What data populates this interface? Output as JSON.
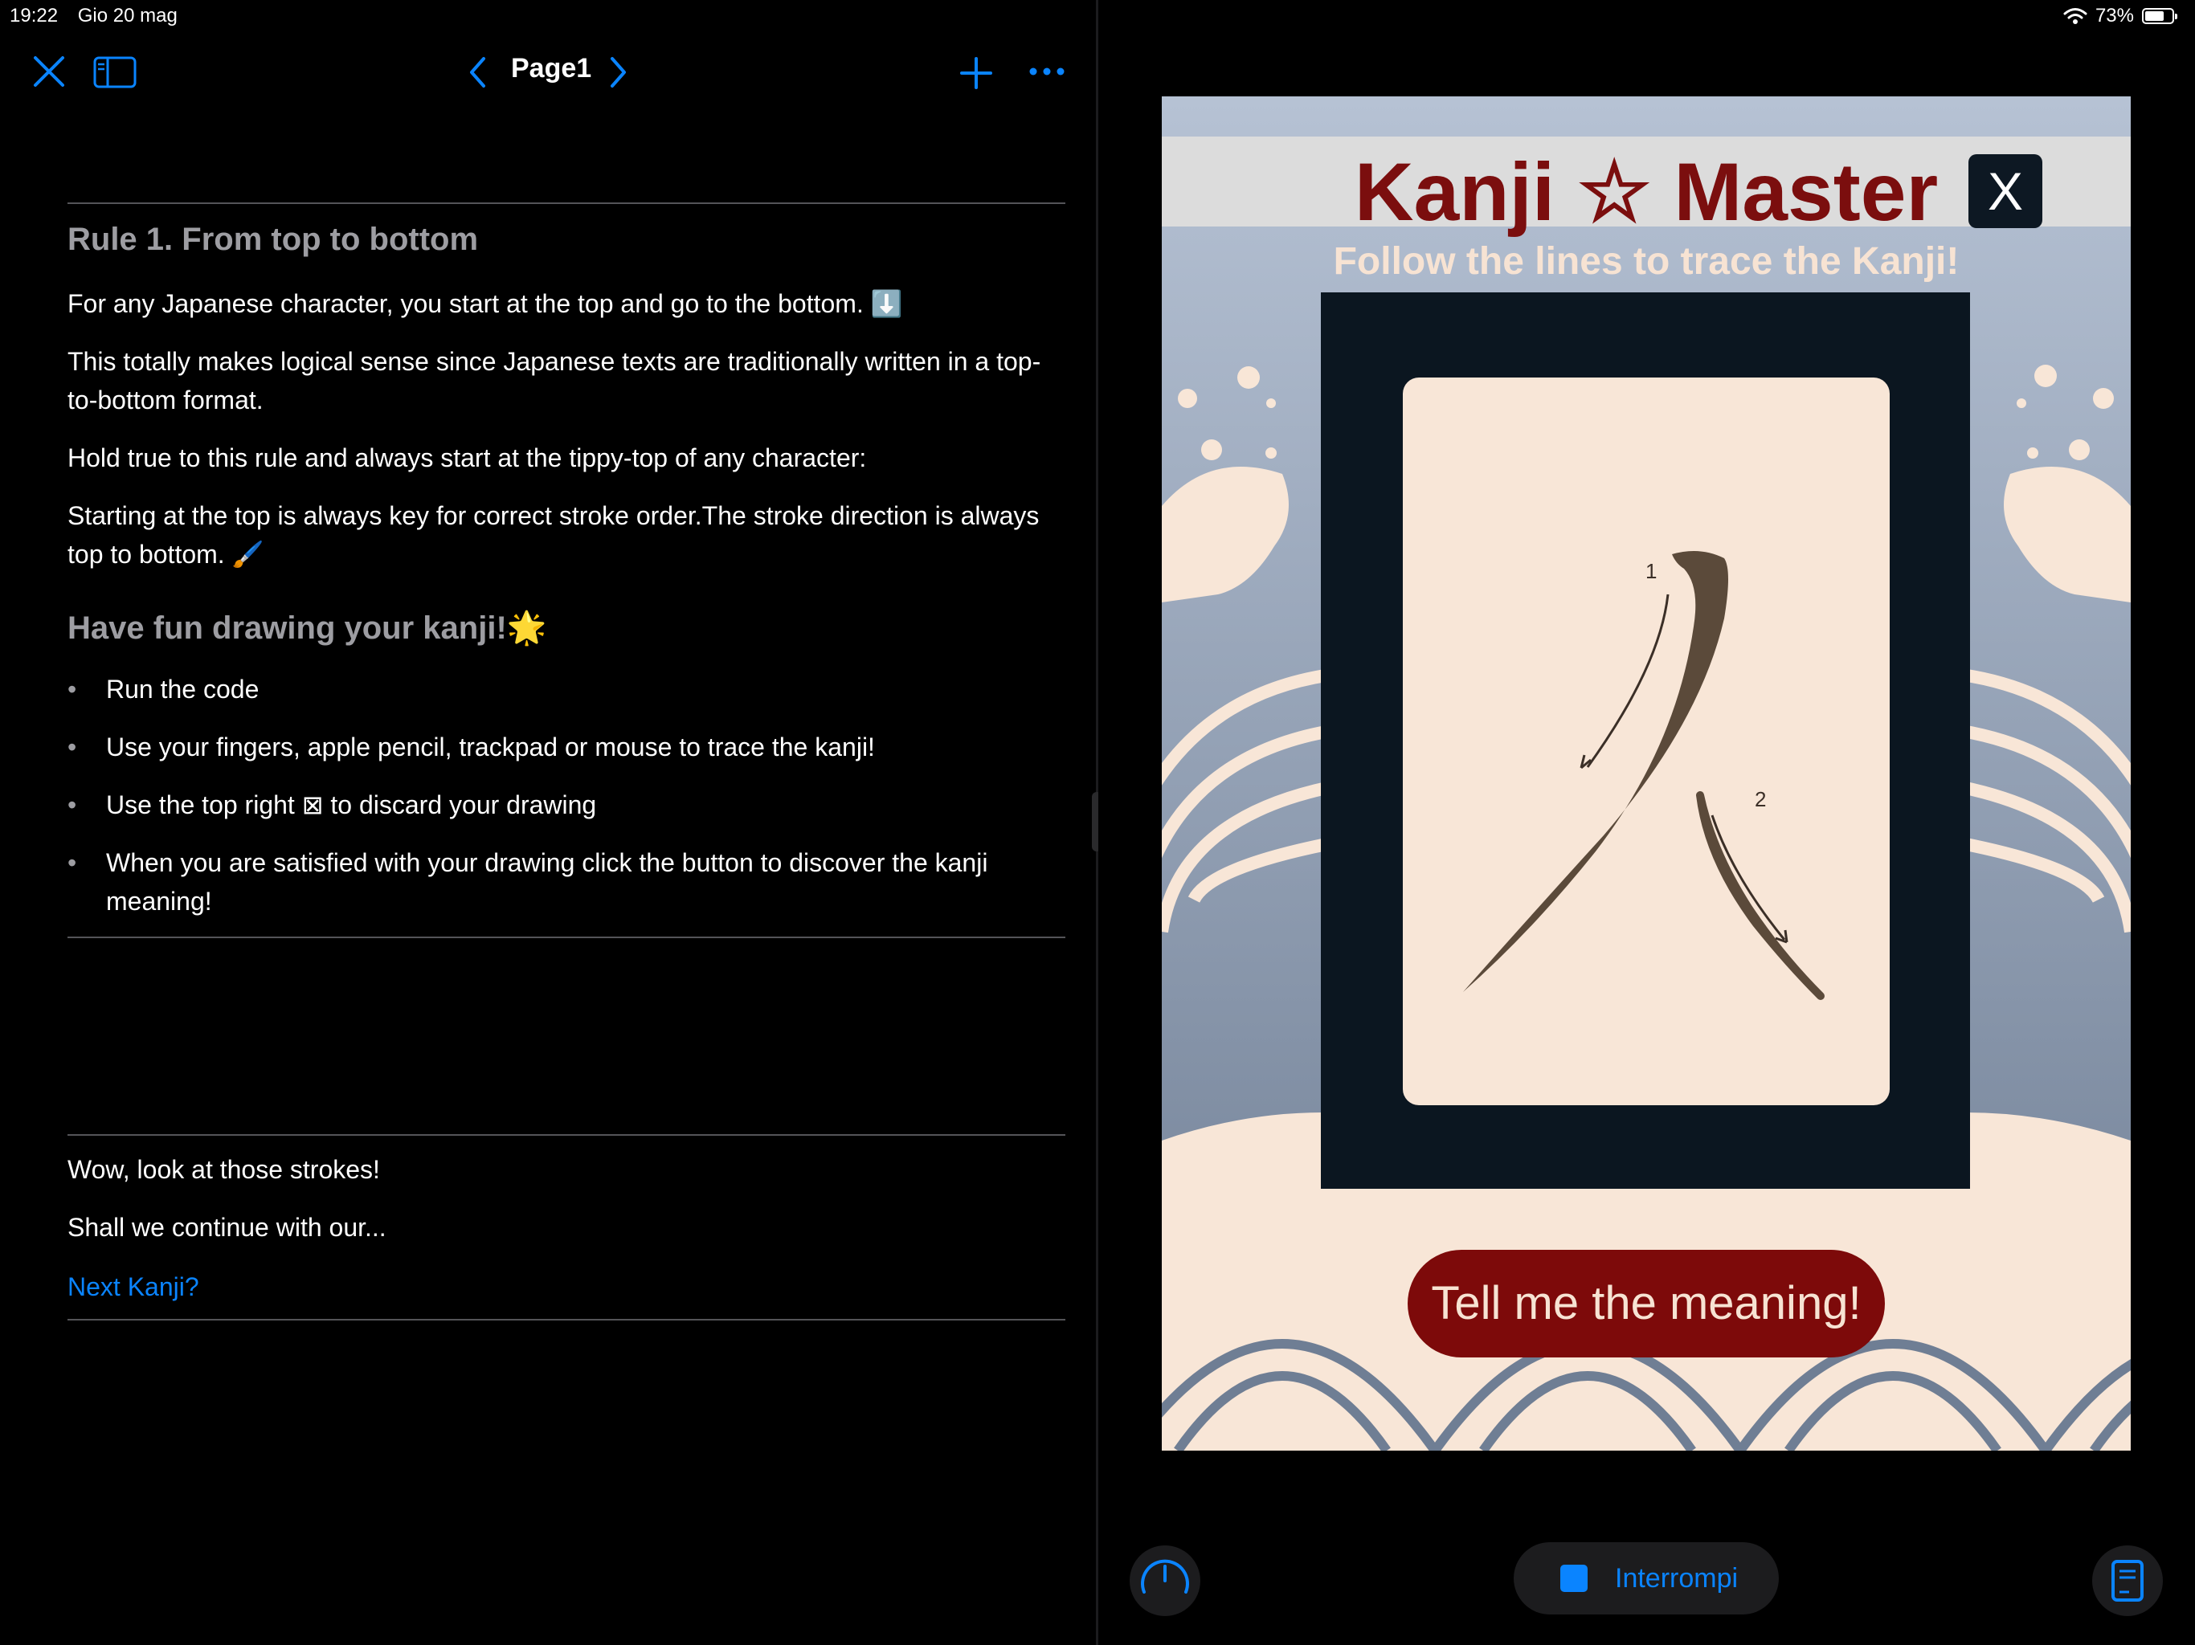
{
  "status_bar": {
    "time": "19:22",
    "date": "Gio 20 mag",
    "battery": "73%",
    "battery_level": 0.73
  },
  "editor": {
    "page_title": "Page1",
    "rule_title": "Rule 1. From top to bottom",
    "paragraphs": [
      "For any Japanese character, you start at the top and go to the bottom. ⬇️",
      "This totally makes logical sense since Japanese texts are traditionally written in a top-to-bottom format.",
      "Hold true to this rule and always start at the tippy-top of any character:",
      "Starting at the top is always key for correct stroke order.The stroke direction is always top to bottom. 🖌️"
    ],
    "fun_title": "Have fun drawing your kanji!🌟",
    "bullets": [
      "Run the code",
      "Use your fingers, apple pencil, trackpad or mouse to trace the kanji!",
      "Use the top right ⊠ to discard your drawing",
      "When you are satisfied with your drawing click the button to discover the kanji meaning!"
    ],
    "footer_lines": [
      "Wow, look at those strokes!",
      "Shall we continue with our..."
    ],
    "next_link": "Next Kanji?"
  },
  "app": {
    "title": "Kanji ☆ Master",
    "subtitle": "Follow the lines to trace the Kanji!",
    "close_label": "X",
    "stroke_numbers": [
      "1",
      "2"
    ],
    "meaning_button": "Tell me the meaning!"
  },
  "run_controls": {
    "stop_label": "Interrompi"
  },
  "colors": {
    "accent": "#0a84ff",
    "kanji_red": "#7b0e0e",
    "canvas": "#f8e6d7",
    "navy": "#0b1620"
  }
}
